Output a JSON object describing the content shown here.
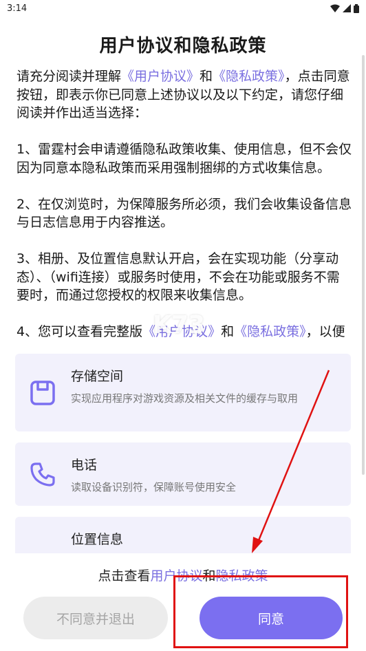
{
  "status_bar": {
    "time": "3:14"
  },
  "dialog": {
    "title": "用户协议和隐私政策",
    "intro": {
      "pre": "请充分阅读并理解",
      "link1": "《用户协议》",
      "mid": "和",
      "link2": "《隐私政策》",
      "post": "，点击同意按钮，即表示你已同意上述协议以及以下约定，请您仔细阅读并作出适当选择："
    },
    "clause1": "1、雷霆村会申请遵循隐私政策收集、使用信息，但不会仅因为同意本隐私政策而采用强制捆绑的方式收集信息。",
    "clause2": "2、在仅浏览时，为保障服务所必须，我们会收集设备信息与日志信息用于内容推送。",
    "clause3": "3、相册、及位置信息默认开启，会在实现功能（分享动态）、（wifi连接）或服务时使用，不会在功能或服务不需要时，而通过您授权的权限来收集信息。",
    "clause4": {
      "pre": "4、您可以查看完整版",
      "link1": "《用户协议》",
      "mid": "和",
      "link2": "《隐私政策》",
      "post": "，以便了解我们收集、使用、共享、存储信息的"
    }
  },
  "permissions": [
    {
      "title": "存储空间",
      "desc": "实现应用程序对游戏资源及相关文件的缓存与取用",
      "icon": "save-icon"
    },
    {
      "title": "电话",
      "desc": "读取设备识别符，保障账号使用安全",
      "icon": "phone-icon"
    },
    {
      "title": "位置信息",
      "desc": "",
      "icon": "location-icon"
    }
  ],
  "footer": {
    "prefix": "点击查看",
    "link_user": "用户协议",
    "and": "和",
    "link_privacy": "隐私政策",
    "decline_label": "不同意并退出",
    "agree_label": "同意"
  },
  "watermark": "K73",
  "colors": {
    "accent": "#7b6ff0",
    "link": "#7a6fe0",
    "card_bg": "#f2f1fc",
    "annotation": "#e01212"
  }
}
